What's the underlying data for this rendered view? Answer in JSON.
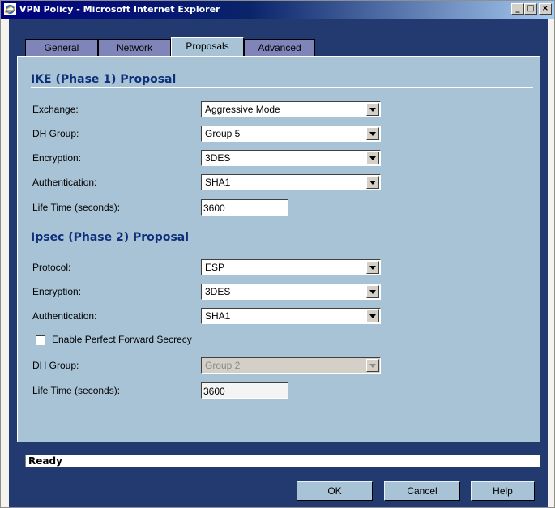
{
  "window": {
    "title": "VPN Policy - Microsoft Internet Explorer",
    "min_glyph": "_",
    "max_glyph": "□",
    "close_glyph": "×"
  },
  "tabs": [
    {
      "label": "General",
      "active": false
    },
    {
      "label": "Network",
      "active": false
    },
    {
      "label": "Proposals",
      "active": true
    },
    {
      "label": "Advanced",
      "active": false
    }
  ],
  "ike": {
    "title": "IKE (Phase 1) Proposal",
    "exchange_label": "Exchange:",
    "exchange_value": "Aggressive Mode",
    "dh_group_label": "DH Group:",
    "dh_group_value": "Group 5",
    "encryption_label": "Encryption:",
    "encryption_value": "3DES",
    "authentication_label": "Authentication:",
    "authentication_value": "SHA1",
    "lifetime_label": "Life Time (seconds):",
    "lifetime_value": "3600"
  },
  "ipsec": {
    "title": "Ipsec (Phase 2) Proposal",
    "protocol_label": "Protocol:",
    "protocol_value": "ESP",
    "encryption_label": "Encryption:",
    "encryption_value": "3DES",
    "authentication_label": "Authentication:",
    "authentication_value": "SHA1",
    "pfs_label": "Enable Perfect Forward Secrecy",
    "pfs_checked": false,
    "dh_group_label": "DH Group:",
    "dh_group_value": "Group 2",
    "lifetime_label": "Life Time (seconds):",
    "lifetime_value": "3600"
  },
  "status_text": "Ready",
  "buttons": {
    "ok": "OK",
    "cancel": "Cancel",
    "help": "Help"
  },
  "colors": {
    "background": "#233a70",
    "panel": "#a8c3d6",
    "inactive_tab": "#7f85b8",
    "section_title": "#0d2f7a"
  }
}
